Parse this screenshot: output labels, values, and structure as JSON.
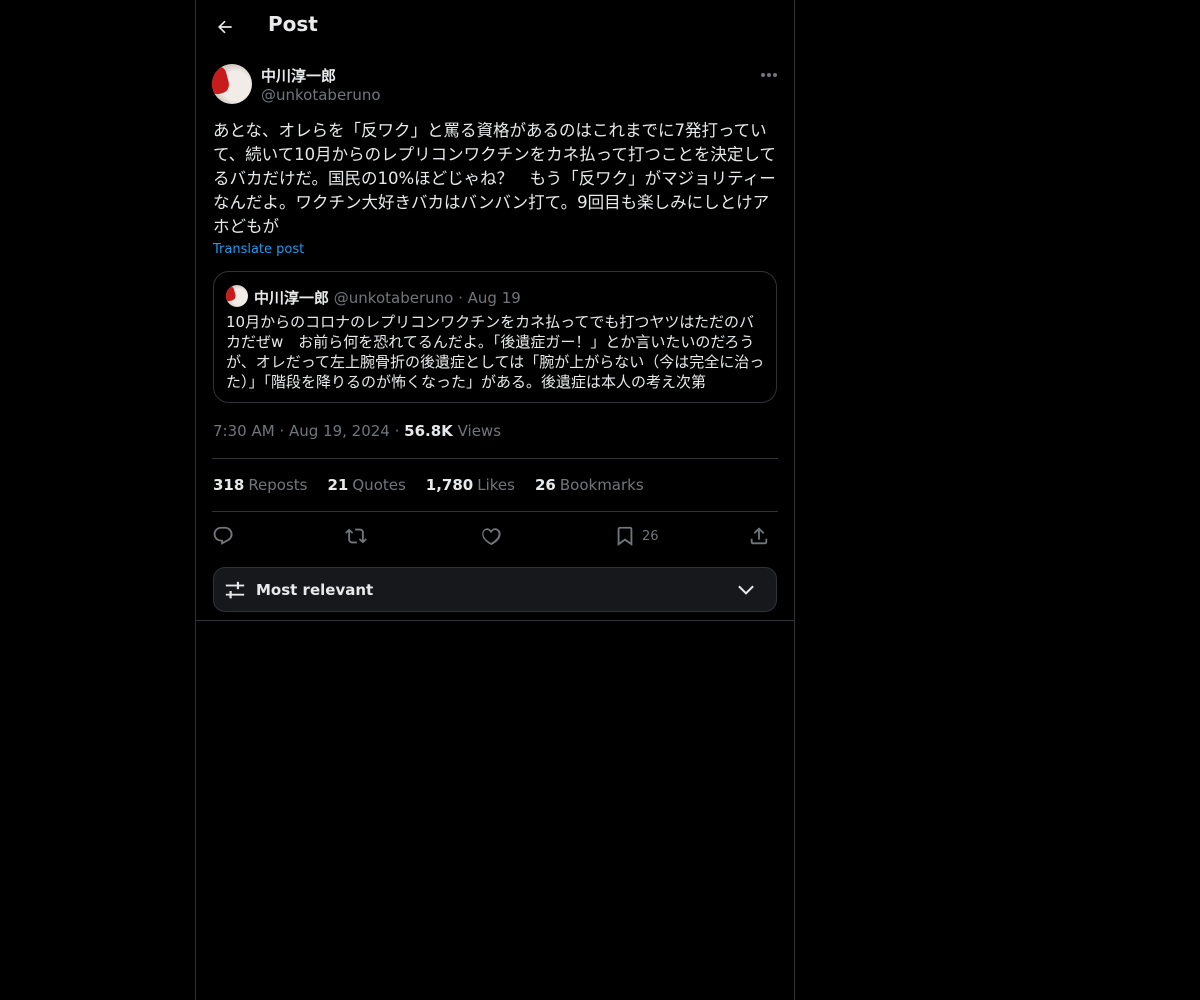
{
  "header": {
    "title": "Post",
    "back_icon": "arrow-left-icon"
  },
  "post": {
    "author_name": "中川淳一郎",
    "author_handle": "@unkotaberuno",
    "text": "あとな、オレらを「反ワク」と罵る資格があるのはこれまでに7発打っていて、続いて10月からのレプリコンワクチンをカネ払って打つことを決定してるバカだけだ。国民の10%ほどじゃね？　もう「反ワク」がマジョリティーなんだよ。ワクチン大好きバカはバンバン打て。9回目も楽しみにしとけアホどもが",
    "translate_label": "Translate post",
    "time": "7:30 AM",
    "date": "Aug 19, 2024",
    "views_count": "56.8K",
    "views_label": "Views"
  },
  "quote": {
    "author_name": "中川淳一郎",
    "author_handle": "@unkotaberuno",
    "date": "Aug 19",
    "text": "10月からのコロナのレプリコンワクチンをカネ払ってでも打つヤツはただのバカだぜw　お前ら何を恐れてるんだよ。「後遺症ガー！」とか言いたいのだろうが、オレだって左上腕骨折の後遺症としては「腕が上がらない（今は完全に治った）」「階段を降りるのが怖くなった」がある。後遺症は本人の考え次第"
  },
  "stats": {
    "reposts": {
      "count": "318",
      "label": "Reposts"
    },
    "quotes": {
      "count": "21",
      "label": "Quotes"
    },
    "likes": {
      "count": "1,780",
      "label": "Likes"
    },
    "bookmarks": {
      "count": "26",
      "label": "Bookmarks"
    }
  },
  "actions": {
    "bookmark_count": "26"
  },
  "sort": {
    "label": "Most relevant"
  },
  "colors": {
    "background": "#000000",
    "text": "#e7e9ea",
    "muted": "#71767b",
    "accent": "#1d9bf0",
    "border": "#2f3336"
  }
}
